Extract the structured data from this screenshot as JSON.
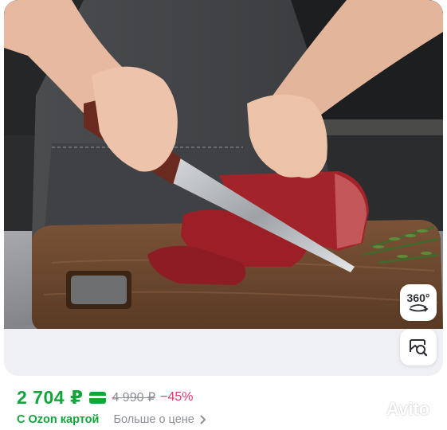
{
  "product": {
    "image_alt": "Hands slicing raw beef with a chef knife on a wooden cutting board",
    "buttons": {
      "view360_label": "360°",
      "view360_icon": "rotate-360-icon",
      "lens_icon": "image-search-icon"
    }
  },
  "price": {
    "current": "2 704 ₽",
    "card_icon": "payment-card-icon",
    "old": "4 990 ₽",
    "discount": "−45%",
    "card_note": "С Ozon картой",
    "more_link": "Больше о цене",
    "more_icon": "chevron-right-icon"
  },
  "watermark": {
    "text": "Avito"
  },
  "colors": {
    "price_green": "#11a63b",
    "discount_pink": "#e8356d",
    "muted_gray": "#8b8f96"
  }
}
